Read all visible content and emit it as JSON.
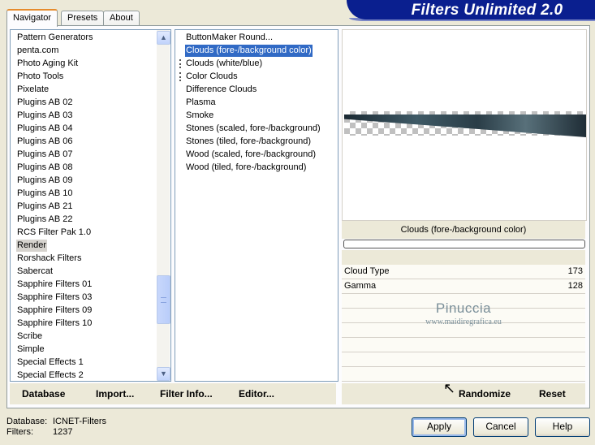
{
  "app": {
    "title": "Filters Unlimited 2.0"
  },
  "tabs": [
    {
      "label": "Navigator",
      "active": true
    },
    {
      "label": "Presets",
      "active": false
    },
    {
      "label": "About",
      "active": false
    }
  ],
  "categories": {
    "items": [
      "Pattern Generators",
      "penta.com",
      "Photo Aging Kit",
      "Photo Tools",
      "Pixelate",
      "Plugins AB 02",
      "Plugins AB 03",
      "Plugins AB 04",
      "Plugins AB 06",
      "Plugins AB 07",
      "Plugins AB 08",
      "Plugins AB 09",
      "Plugins AB 10",
      "Plugins AB 21",
      "Plugins AB 22",
      "RCS Filter Pak 1.0",
      "Render",
      "Rorshack Filters",
      "Sabercat",
      "Sapphire Filters 01",
      "Sapphire Filters 03",
      "Sapphire Filters 09",
      "Sapphire Filters 10",
      "Scribe",
      "Simple",
      "Special Effects 1",
      "Special Effects 2"
    ],
    "selected": "Render"
  },
  "filters": {
    "items": [
      "ButtonMaker Round...",
      "Clouds (fore-/background color)",
      "Clouds (white/blue)",
      "Color Clouds",
      "Difference Clouds",
      "Plasma",
      "Smoke",
      "Stones (scaled, fore-/background)",
      "Stones (tiled, fore-/background)",
      "Wood (scaled, fore-/background)",
      "Wood (tiled, fore-/background)"
    ],
    "selected": "Clouds (fore-/background color)"
  },
  "preview": {
    "filter_name": "Clouds (fore-/background color)",
    "params": [
      {
        "label": "Cloud Type",
        "value": "173"
      },
      {
        "label": "Gamma",
        "value": "128"
      }
    ],
    "watermark": {
      "name": "Pinuccia",
      "site": "www.maidiregrafica.eu"
    }
  },
  "commands": {
    "database": "Database",
    "import": "Import...",
    "filter_info": "Filter Info...",
    "editor": "Editor...",
    "randomize": "Randomize",
    "reset": "Reset"
  },
  "status": {
    "database_label": "Database:",
    "database_value": "ICNET-Filters",
    "filters_label": "Filters:",
    "filters_value": "1237"
  },
  "buttons": {
    "apply": "Apply",
    "cancel": "Cancel",
    "help": "Help"
  },
  "colors": {
    "banner": "#0a1f8f",
    "selection": "#316ac5",
    "tab_accent": "#e68b2c"
  }
}
